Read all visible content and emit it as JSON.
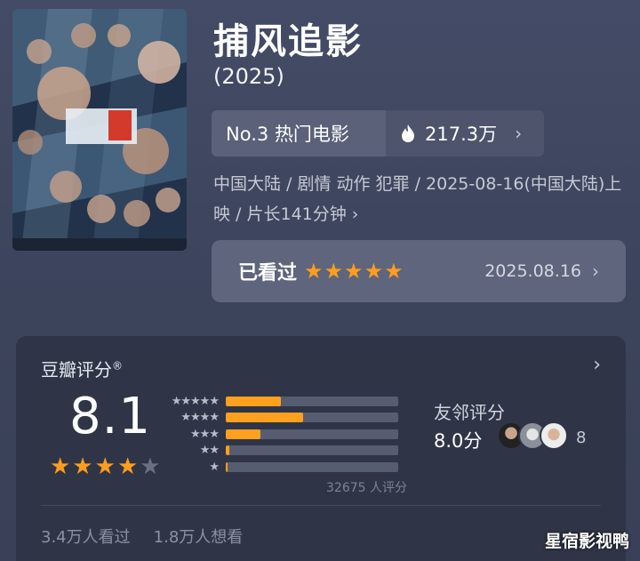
{
  "movie": {
    "title": "捕风追影",
    "year": "(2025)",
    "rank_label": "No.3 热门电影",
    "heat_value": "217.3万",
    "meta_text": "中国大陆 / 剧情 动作 犯罪 / 2025-08-16(中国大陆)上映 / 片长141分钟 ›"
  },
  "watched": {
    "label": "已看过",
    "stars": 5,
    "date": "2025.08.16"
  },
  "rating": {
    "title": "豆瓣评分",
    "registered_mark": "®",
    "score": "8.1",
    "stars_filled": 4,
    "stars_total": 5,
    "distribution": [
      {
        "stars": "★★★★★",
        "fraction": 0.32
      },
      {
        "stars": "★★★★",
        "fraction": 0.45
      },
      {
        "stars": "★★★",
        "fraction": 0.2
      },
      {
        "stars": "★★",
        "fraction": 0.02
      },
      {
        "stars": "★",
        "fraction": 0.01
      }
    ],
    "count_text": "32675 人评分",
    "friends_title": "友邻评分",
    "friends_score": "8.0分",
    "friends_count": "8",
    "watched_text": "3.4万人看过",
    "want_text": "1.8万人想看"
  },
  "watermark": "星宿影视鸭",
  "icons": {
    "flame": "flame-icon",
    "chevron": "chevron-right-icon",
    "star": "star-icon"
  },
  "colors": {
    "accent_star": "#ff9d1e",
    "bar_fill": "#ffa01e"
  }
}
